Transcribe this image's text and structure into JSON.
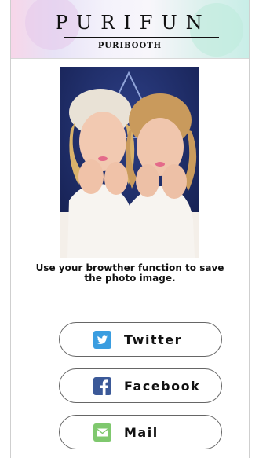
{
  "header": {
    "logo": "PURIFUN",
    "brand": "PURIBOOTH"
  },
  "photo": {
    "alt": "Photo booth picture of two women"
  },
  "instruction": {
    "line1": "Use your browther function to save",
    "line2": "the photo image."
  },
  "share": [
    {
      "label": "Twitter",
      "icon": "twitter-icon",
      "color": "#3a9de0"
    },
    {
      "label": "Facebook",
      "icon": "facebook-icon",
      "color": "#3b5998"
    },
    {
      "label": "Mail",
      "icon": "mail-icon",
      "color": "#7fc86e"
    }
  ]
}
